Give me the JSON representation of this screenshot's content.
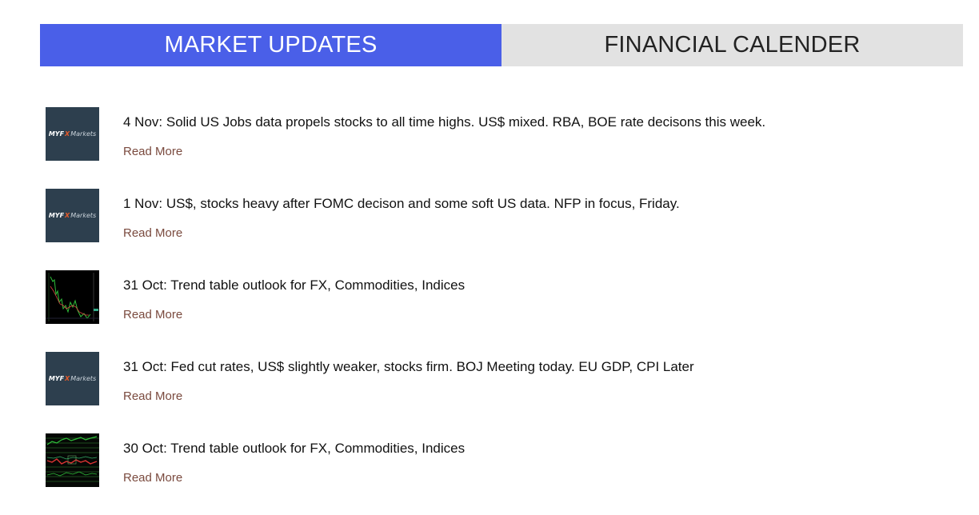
{
  "tabs": {
    "market_updates": "MARKET UPDATES",
    "financial_calendar": "FINANCIAL CALENDER"
  },
  "colors": {
    "active_tab": "#4a5fe8",
    "inactive_tab": "#e2e2e2",
    "read_more": "#7a4a3e",
    "logo_bg": "#2d3f4e"
  },
  "logo": {
    "brand": "MYF",
    "x": "X",
    "markets": "Markets"
  },
  "updates": [
    {
      "thumb": "myfx-logo",
      "title": "4 Nov: Solid US Jobs data propels stocks to all time highs. US$ mixed. RBA, BOE rate decisons this week.",
      "read_more": "Read More"
    },
    {
      "thumb": "myfx-logo",
      "title": "1 Nov: US$, stocks heavy after FOMC decison and some soft US data. NFP in focus, Friday.",
      "read_more": "Read More"
    },
    {
      "thumb": "chart-screenshot",
      "title": "31 Oct: Trend table outlook for FX, Commodities, Indices",
      "read_more": "Read More"
    },
    {
      "thumb": "myfx-logo",
      "title": "31 Oct: Fed cut rates, US$ slightly weaker, stocks firm. BOJ Meeting today. EU GDP, CPI Later",
      "read_more": "Read More"
    },
    {
      "thumb": "table-screenshot",
      "title": "30 Oct: Trend table outlook for FX, Commodities, Indices",
      "read_more": "Read More"
    }
  ]
}
